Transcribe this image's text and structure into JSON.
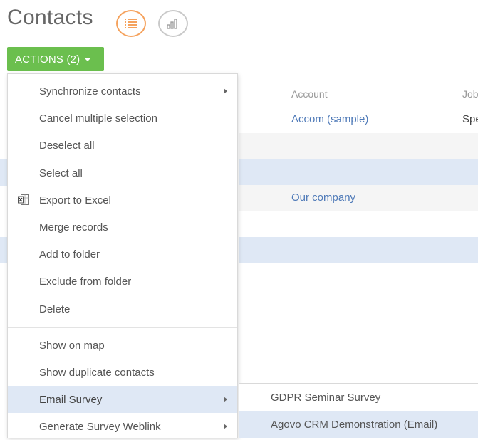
{
  "page": {
    "title": "Contacts"
  },
  "toolbar": {
    "list_view_icon": "list-view-icon",
    "analytics_view_icon": "bar-chart-icon",
    "actions_label": "ACTIONS (2)"
  },
  "grid": {
    "columns": {
      "account": "Account",
      "job": "Job"
    },
    "rows": [
      {
        "account": "Accom (sample)",
        "job": "Spe",
        "style": "white"
      },
      {
        "account": "",
        "job": "",
        "style": "gray"
      },
      {
        "account": "",
        "job": "",
        "style": "blue"
      },
      {
        "account": "Our company",
        "job": "",
        "style": "gray"
      },
      {
        "account": "",
        "job": "",
        "style": "white"
      },
      {
        "account": "",
        "job": "",
        "style": "blue"
      }
    ]
  },
  "menu": {
    "items": [
      {
        "label": "Synchronize contacts",
        "has_submenu": true
      },
      {
        "label": "Cancel multiple selection"
      },
      {
        "label": "Deselect all"
      },
      {
        "label": "Select all"
      },
      {
        "label": "Export to Excel",
        "icon": "excel-icon"
      },
      {
        "label": "Merge records"
      },
      {
        "label": "Add to folder"
      },
      {
        "label": "Exclude from folder"
      },
      {
        "label": "Delete"
      },
      {
        "label": "Show on map"
      },
      {
        "label": "Show duplicate contacts"
      },
      {
        "label": "Email Survey",
        "has_submenu": true,
        "highlighted": true
      },
      {
        "label": "Generate Survey Weblink",
        "has_submenu": true
      }
    ]
  },
  "submenu": {
    "items": [
      {
        "label": "GDPR Seminar Survey"
      },
      {
        "label": "Agovo CRM Demonstration (Email)",
        "highlighted": true
      }
    ]
  },
  "colors": {
    "actions_green": "#6bbf4e",
    "list_icon_orange": "#f5a25d",
    "link_blue": "#4f7ab8",
    "selection_blue": "#dfe8f5"
  }
}
